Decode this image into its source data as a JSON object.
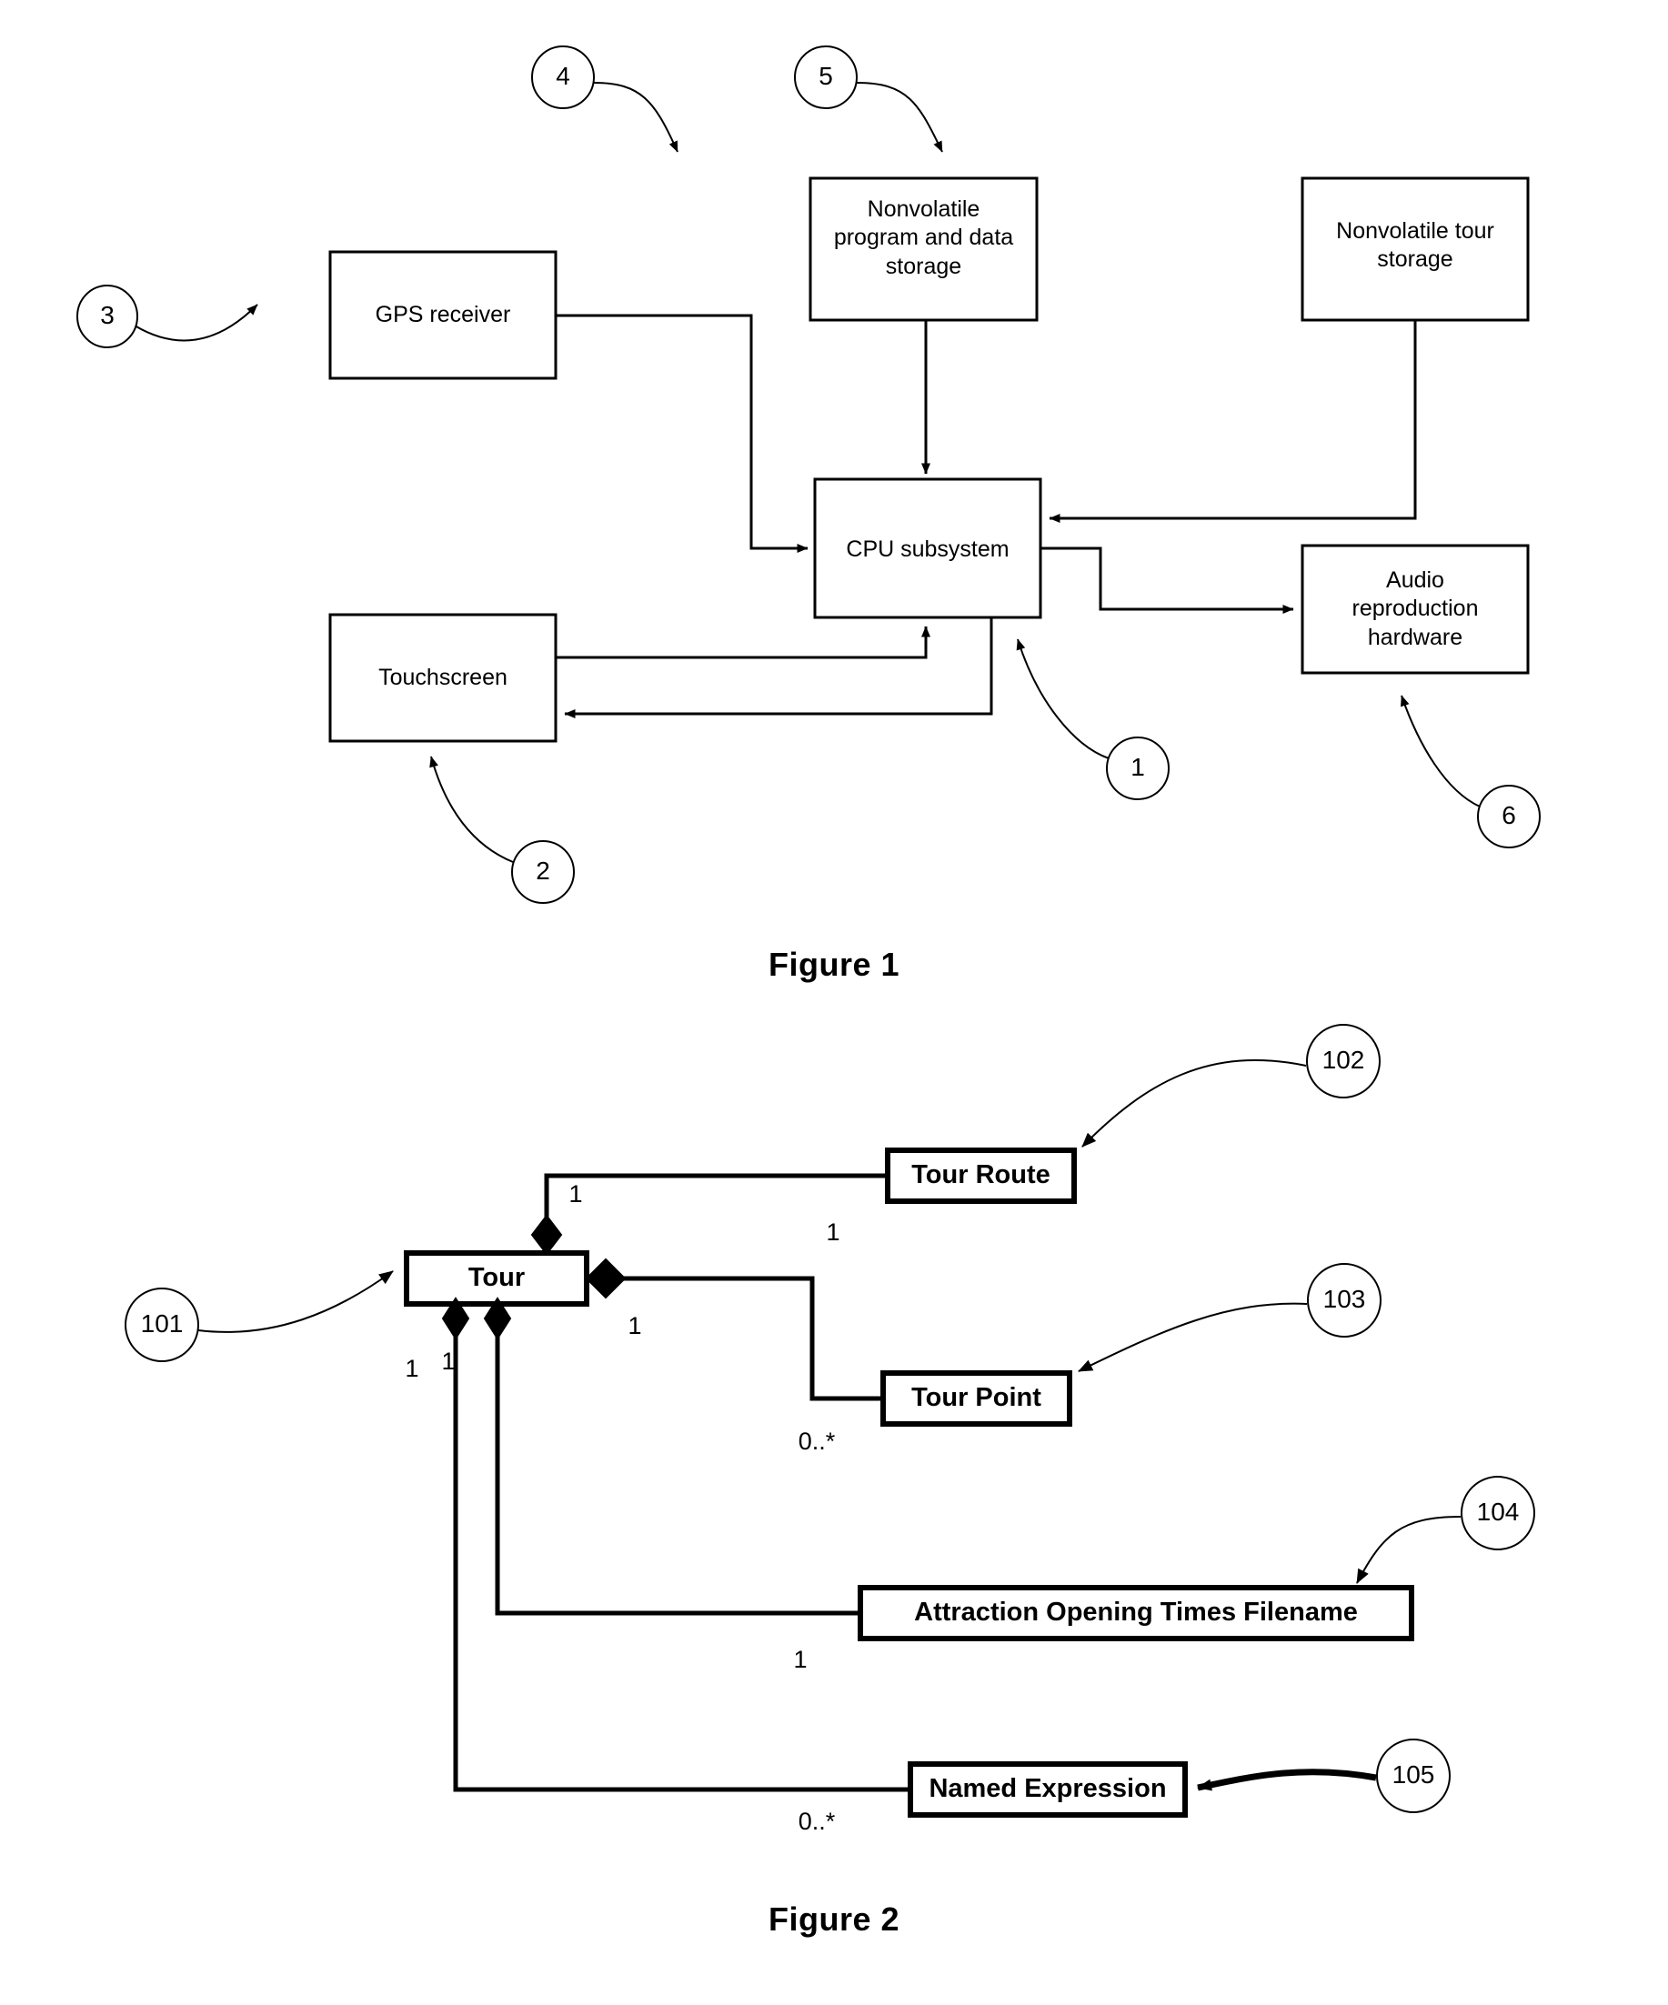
{
  "figure1": {
    "caption": "Figure 1",
    "nodes": [
      {
        "id": "gps",
        "label": "GPS receiver"
      },
      {
        "id": "nvprog",
        "label": "Nonvolatile\nprogram and data\nstorage"
      },
      {
        "id": "nvtour",
        "label": "Nonvolatile tour\nstorage"
      },
      {
        "id": "cpu",
        "label": "CPU subsystem"
      },
      {
        "id": "touch",
        "label": "Touchscreen"
      },
      {
        "id": "audio",
        "label": "Audio\nreproduction\nhardware"
      }
    ],
    "reference_callouts": [
      {
        "id": "r3",
        "number": "3",
        "points_to": "GPS receiver"
      },
      {
        "id": "r4",
        "number": "4",
        "points_to": "Nonvolatile program and data storage"
      },
      {
        "id": "r5",
        "number": "5",
        "points_to": "Nonvolatile tour storage"
      },
      {
        "id": "r1",
        "number": "1",
        "points_to": "CPU subsystem"
      },
      {
        "id": "r2",
        "number": "2",
        "points_to": "Touchscreen"
      },
      {
        "id": "r6",
        "number": "6",
        "points_to": "Audio reproduction hardware"
      }
    ]
  },
  "figure2": {
    "caption": "Figure 2",
    "classes": [
      {
        "id": "tour",
        "label": "Tour"
      },
      {
        "id": "tourroute",
        "label": "Tour Route"
      },
      {
        "id": "tourpoint",
        "label": "Tour Point"
      },
      {
        "id": "attraction",
        "label": "Attraction Opening Times Filename"
      },
      {
        "id": "namedexpr",
        "label": "Named Expression"
      }
    ],
    "multiplicities": [
      {
        "id": "m-route-near",
        "text": "1"
      },
      {
        "id": "m-route-far",
        "text": "1"
      },
      {
        "id": "m-point-near",
        "text": "1"
      },
      {
        "id": "m-point-far",
        "text": "0..*"
      },
      {
        "id": "m-attr-near",
        "text": "1"
      },
      {
        "id": "m-attr-far",
        "text": "1"
      },
      {
        "id": "m-expr-near",
        "text": "1"
      },
      {
        "id": "m-expr-far",
        "text": "0..*"
      }
    ],
    "reference_callouts": [
      {
        "id": "r101",
        "number": "101",
        "points_to": "Tour"
      },
      {
        "id": "r102",
        "number": "102",
        "points_to": "Tour Route"
      },
      {
        "id": "r103",
        "number": "103",
        "points_to": "Tour Point"
      },
      {
        "id": "r104",
        "number": "104",
        "points_to": "Attraction Opening Times Filename"
      },
      {
        "id": "r105",
        "number": "105",
        "points_to": "Named Expression"
      }
    ]
  },
  "colors": {
    "ink": "#000000",
    "paper": "#ffffff"
  }
}
